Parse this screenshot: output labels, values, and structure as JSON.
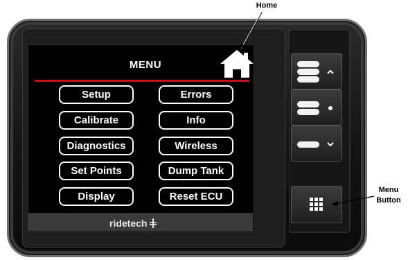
{
  "annotations": {
    "home_label": "Home",
    "menu_button_label_line1": "Menu",
    "menu_button_label_line2": "Button"
  },
  "screen": {
    "title": "MENU",
    "brand": "ridetech",
    "menu_items": {
      "setup": "Setup",
      "errors": "Errors",
      "calibrate": "Calibrate",
      "info": "Info",
      "diagnostics": "Diagnostics",
      "wireless": "Wireless",
      "set_points": "Set Points",
      "dump_tank": "Dump Tank",
      "display": "Display",
      "reset_ecu": "Reset ECU"
    }
  },
  "hardware_buttons": {
    "up": "three-bars-up-icon",
    "middle": "two-bars-dot-icon",
    "down": "one-bar-down-icon",
    "menu": "grid-icon"
  },
  "colors": {
    "accent_red": "#c2141a",
    "screen_bg": "#000000",
    "device_body": "#141414"
  }
}
